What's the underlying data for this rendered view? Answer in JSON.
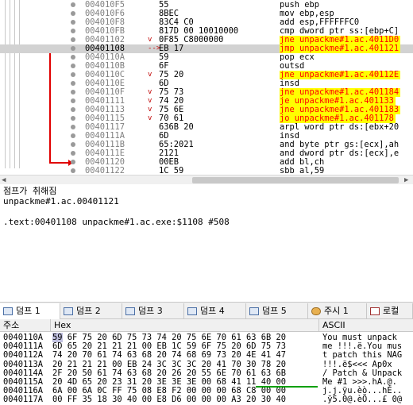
{
  "disasm": {
    "rows": [
      {
        "addr": "004010F5",
        "jm": "",
        "bytes": "55",
        "instr": "push ebp",
        "style": "plain"
      },
      {
        "addr": "004010F6",
        "jm": "",
        "bytes": "8BEC",
        "instr": "mov ebp,esp",
        "style": "plain"
      },
      {
        "addr": "004010F8",
        "jm": "",
        "bytes": "83C4 C0",
        "instr": "add esp,FFFFFFC0",
        "style": "plain"
      },
      {
        "addr": "004010FB",
        "jm": "",
        "bytes": "817D 00 10010000",
        "instr": "cmp dword ptr ss:[ebp+C]",
        "style": "plain"
      },
      {
        "addr": "00401102",
        "jm": "v",
        "bytes": "0F85 C8000000",
        "instr": "jne unpackme#1.ac.4011D0",
        "style": "jcc"
      },
      {
        "addr": "00401108",
        "jm": "-->",
        "bytes": "EB 17",
        "instr": "jmp unpackme#1.ac.401121",
        "style": "jmp"
      },
      {
        "addr": "0040110A",
        "jm": "",
        "bytes": "59",
        "instr": "pop ecx",
        "style": "plain"
      },
      {
        "addr": "0040110B",
        "jm": "",
        "bytes": "6F",
        "instr": "outsd",
        "style": "plain"
      },
      {
        "addr": "0040110C",
        "jm": "v",
        "bytes": "75 20",
        "instr": "jne unpackme#1.ac.40112E",
        "style": "jcc"
      },
      {
        "addr": "0040110E",
        "jm": "",
        "bytes": "6D",
        "instr": "insd",
        "style": "plain"
      },
      {
        "addr": "0040110F",
        "jm": "v",
        "bytes": "75 73",
        "instr": "jne unpackme#1.ac.401184",
        "style": "jcc"
      },
      {
        "addr": "00401111",
        "jm": "v",
        "bytes": "74 20",
        "instr": "je unpackme#1.ac.401133",
        "style": "jcc"
      },
      {
        "addr": "00401113",
        "jm": "v",
        "bytes": "75 6E",
        "instr": "jne unpackme#1.ac.401183",
        "style": "jcc"
      },
      {
        "addr": "00401115",
        "jm": "v",
        "bytes": "70 61",
        "instr": "jo unpackme#1.ac.401178",
        "style": "jcc"
      },
      {
        "addr": "00401117",
        "jm": "",
        "bytes": "636B 20",
        "instr": "arpl word ptr ds:[ebx+20",
        "style": "plain"
      },
      {
        "addr": "0040111A",
        "jm": "",
        "bytes": "6D",
        "instr": "insd",
        "style": "plain"
      },
      {
        "addr": "0040111B",
        "jm": "",
        "bytes": "65:2021",
        "instr": "and byte ptr gs:[ecx],ah",
        "style": "plain"
      },
      {
        "addr": "0040111E",
        "jm": "",
        "bytes": "2121",
        "instr": "and dword ptr ds:[ecx],e",
        "style": "plain"
      },
      {
        "addr": "00401120",
        "jm": "",
        "bytes": "00EB",
        "instr": "add bl,ch",
        "style": "plain"
      },
      {
        "addr": "00401122",
        "jm": "",
        "bytes": "1C 59",
        "instr": "sbb al,59",
        "style": "plain"
      }
    ]
  },
  "info": {
    "line1": "점프가 취해짐",
    "line2": "unpackme#1.ac.00401121",
    "line3": "",
    "line4": ".text:00401108 unpackme#1.ac.exe:$1108 #508"
  },
  "tabs": [
    {
      "label": "덤프 1",
      "icon": "dump-icon",
      "active": true
    },
    {
      "label": "덤프 2",
      "icon": "dump-icon",
      "active": false
    },
    {
      "label": "덤프 3",
      "icon": "dump-icon",
      "active": false
    },
    {
      "label": "덤프 4",
      "icon": "dump-icon",
      "active": false
    },
    {
      "label": "덤프 5",
      "icon": "dump-icon",
      "active": false
    },
    {
      "label": "주시 1",
      "icon": "watch-cat-icon",
      "active": false
    },
    {
      "label": "로컬",
      "icon": "locals-x-icon",
      "active": false
    }
  ],
  "dump": {
    "col_address": "주소",
    "col_hex": "Hex",
    "col_ascii": "ASCII",
    "rows": [
      {
        "addr": "0040110A",
        "first": "59",
        "hex": "6F 75 20 6D 75 73 74 20 75 6E 70 61 63 6B 20",
        "ascii": "You must unpack "
      },
      {
        "addr": "0040111A",
        "first": "6D",
        "hex": "65 20 21 21 21 00 EB 1C 59 6F 75 20 6D 75 73",
        "ascii": "me !!!.ë.You mus"
      },
      {
        "addr": "0040112A",
        "first": "74",
        "hex": "20 70 61 74 63 68 20 74 68 69 73 20 4E 41 47",
        "ascii": "t patch this NAG"
      },
      {
        "addr": "0040113A",
        "first": "20",
        "hex": "21 21 21 00 EB 24 3C 3C 3C 20 41 70 30 78 20",
        "ascii": " !!!.ë$<<< Ap0x "
      },
      {
        "addr": "0040114A",
        "first": "2F",
        "hex": "20 50 61 74 63 68 20 26 20 55 6E 70 61 63 6B",
        "ascii": "/ Patch & Unpack"
      },
      {
        "addr": "0040115A",
        "first": "20",
        "hex": "4D 65 20 23 31 20 3E 3E 3E 00 68 41 11 40 00",
        "ascii": " Me #1 >>>.hA.@."
      },
      {
        "addr": "0040116A",
        "first": "6A",
        "hex": "00 6A 0C FF 75 08 E8 F2 00 00 00 68 C8 00 00",
        "ascii": "j.j.ÿu.èò...hÈ.."
      },
      {
        "addr": "0040117A",
        "first": "00",
        "hex": "FF 35 18 30 40 00 E8 D6 00 00 00 A3 20 30 40",
        "ascii": ".ÿ5.0@.èÖ...£ 0@"
      }
    ]
  },
  "colors": {
    "jump_highlight": "#ffff00",
    "jcc_text": "#ff0000",
    "selected_row": "#d2d2d2",
    "branch_arrow": "#e00000"
  }
}
